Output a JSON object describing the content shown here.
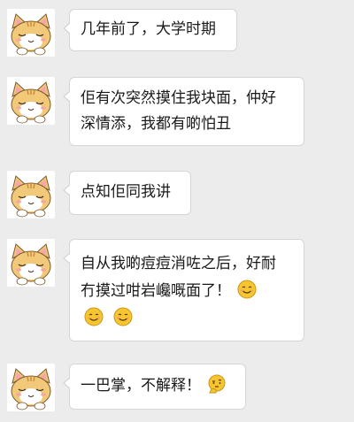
{
  "messages": [
    {
      "text": "几年前了，大学时期",
      "emojis": []
    },
    {
      "text_line1": "佢有次突然摸住我块面，仲好",
      "text_line2": "深情添，我都有啲怕丑",
      "emojis": []
    },
    {
      "text": "点知佢同我讲",
      "emojis": []
    },
    {
      "text_line1": "自从我啲痘痘消咗之后，好耐",
      "text_line2": "冇摸过咁岩巉嘅面了！",
      "emojis": [
        "smiling-face-icon",
        "smiling-face-icon",
        "smiling-face-icon"
      ]
    },
    {
      "text": "一巴掌，不解释！",
      "emojis": [
        "thinking-face-icon"
      ]
    }
  ],
  "colors": {
    "background": "#ececec",
    "bubble": "#ffffff",
    "bubble_border": "#d6d6d6",
    "text": "#1a1a1a",
    "avatar_fur": "#f2c879",
    "emoji_yellow": "#f7c52d"
  }
}
